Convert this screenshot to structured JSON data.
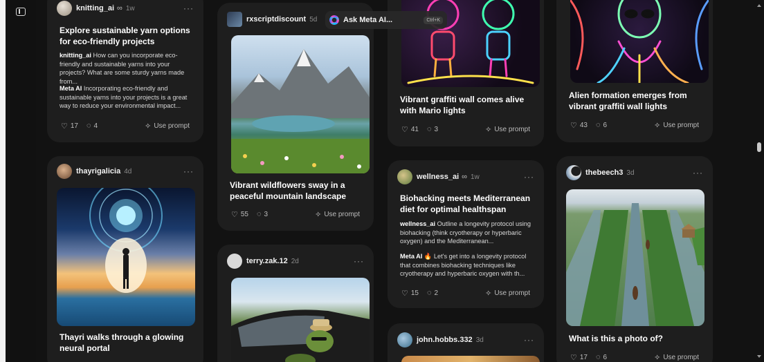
{
  "ask_meta": {
    "label": "Ask Meta AI...",
    "shortcut": "Ctrl+K"
  },
  "posts": {
    "knitting": {
      "user": "knitting_ai",
      "badge": "∞",
      "time": "1w",
      "title": "Explore sustainable yarn options for eco-friendly projects",
      "prompt_user": "knitting_ai",
      "prompt_text": "How can you incorporate eco-friendly and sustainable yarns into your projects? What are some sturdy yarns made from...",
      "reply_user": "Meta AI",
      "reply_text": "Incorporating eco-friendly and sustainable yarns into your projects is a great way to reduce your environmental impact...",
      "likes": "17",
      "comments": "4",
      "use_prompt": "Use prompt"
    },
    "thayri": {
      "user": "thayrigalicia",
      "time": "4d",
      "title": "Thayri walks through a glowing neural portal"
    },
    "rxscript": {
      "user": "rxscriptdiscount",
      "time": "5d",
      "title": "Vibrant wildflowers sway in a peaceful mountain landscape",
      "likes": "55",
      "comments": "3",
      "use_prompt": "Use prompt"
    },
    "terry": {
      "user": "terry.zak.12",
      "time": "2d"
    },
    "mario": {
      "title": "Vibrant graffiti wall comes alive with Mario lights",
      "likes": "41",
      "comments": "3",
      "use_prompt": "Use prompt"
    },
    "wellness": {
      "user": "wellness_ai",
      "badge": "∞",
      "time": "1w",
      "title": "Biohacking meets Mediterranean diet for optimal healthspan",
      "prompt_user": "wellness_ai",
      "prompt_text": "Outline a longevity protocol using biohacking (think cryotherapy or hyperbaric oxygen) and the Mediterranean...",
      "reply_user": "Meta AI",
      "reply_emoji": "🔥",
      "reply_text": "Let's get into a longevity protocol that combines biohacking techniques like cryotherapy and hyperbaric oxygen with th...",
      "likes": "15",
      "comments": "2",
      "use_prompt": "Use prompt"
    },
    "john": {
      "user": "john.hobbs.332",
      "time": "3d"
    },
    "alien": {
      "title": "Alien formation emerges from vibrant graffiti wall lights",
      "likes": "43",
      "comments": "6",
      "use_prompt": "Use prompt"
    },
    "beech": {
      "user": "thebeech3",
      "time": "3d",
      "title": "What is this a photo of?",
      "likes": "17",
      "comments": "6",
      "use_prompt": "Use prompt"
    }
  },
  "icons": {
    "like": "heart-icon",
    "comment": "comment-icon",
    "use_prompt": "sparkle-icon",
    "more": "more-icon",
    "sidebar": "sidebar-toggle-icon",
    "meta_ai": "meta-ai-logo-icon"
  }
}
